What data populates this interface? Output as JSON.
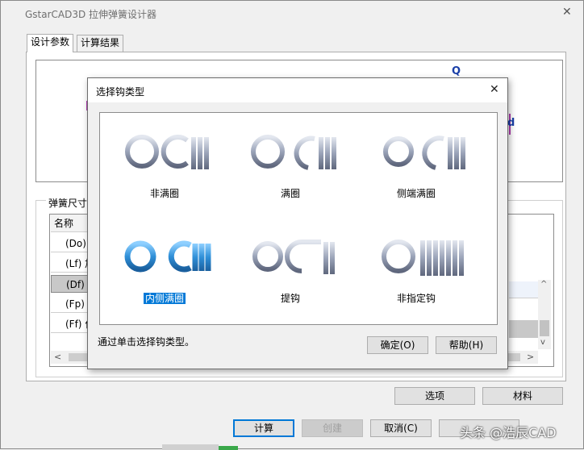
{
  "main_window": {
    "title": "GstarCAD3D 拉伸弹簧设计器",
    "close_glyph": "✕",
    "tabs": [
      {
        "label": "设计参数",
        "active": true
      },
      {
        "label": "计算结果",
        "active": false
      }
    ],
    "preview_glyph_top": "Q",
    "preview_glyph_mid": "d",
    "groupbox_label": "弹簧尺寸",
    "table": {
      "header": "名称",
      "rows": [
        "(Do)",
        "(Lf) 加",
        "(Df) F",
        "(Fp) 预",
        "(Ff) 作"
      ]
    },
    "scroll_left": "<",
    "scroll_right": ">",
    "scroll_up": "^",
    "scroll_down": "v",
    "buttons": {
      "options": "选项",
      "material": "材料",
      "calculate": "计算",
      "create": "创建",
      "cancel": "取消(C)",
      "fourth": ""
    }
  },
  "dialog": {
    "title": "选择钩类型",
    "close_glyph": "✕",
    "hook_types": [
      {
        "label": "非满圈",
        "selected": false
      },
      {
        "label": "满圈",
        "selected": false
      },
      {
        "label": "侧端满圈",
        "selected": false
      },
      {
        "label": "内侧满圈",
        "selected": true
      },
      {
        "label": "提钩",
        "selected": false
      },
      {
        "label": "非指定钩",
        "selected": false
      }
    ],
    "hint": "通过单击选择钩类型。",
    "ok_label": "确定(O)",
    "help_label": "帮助(H)"
  },
  "watermark": "头条 @浩辰CAD",
  "colors": {
    "selection": "#0078d7",
    "spring_gray": "#9fa8bd",
    "spring_blue": "#2f8fd8"
  }
}
